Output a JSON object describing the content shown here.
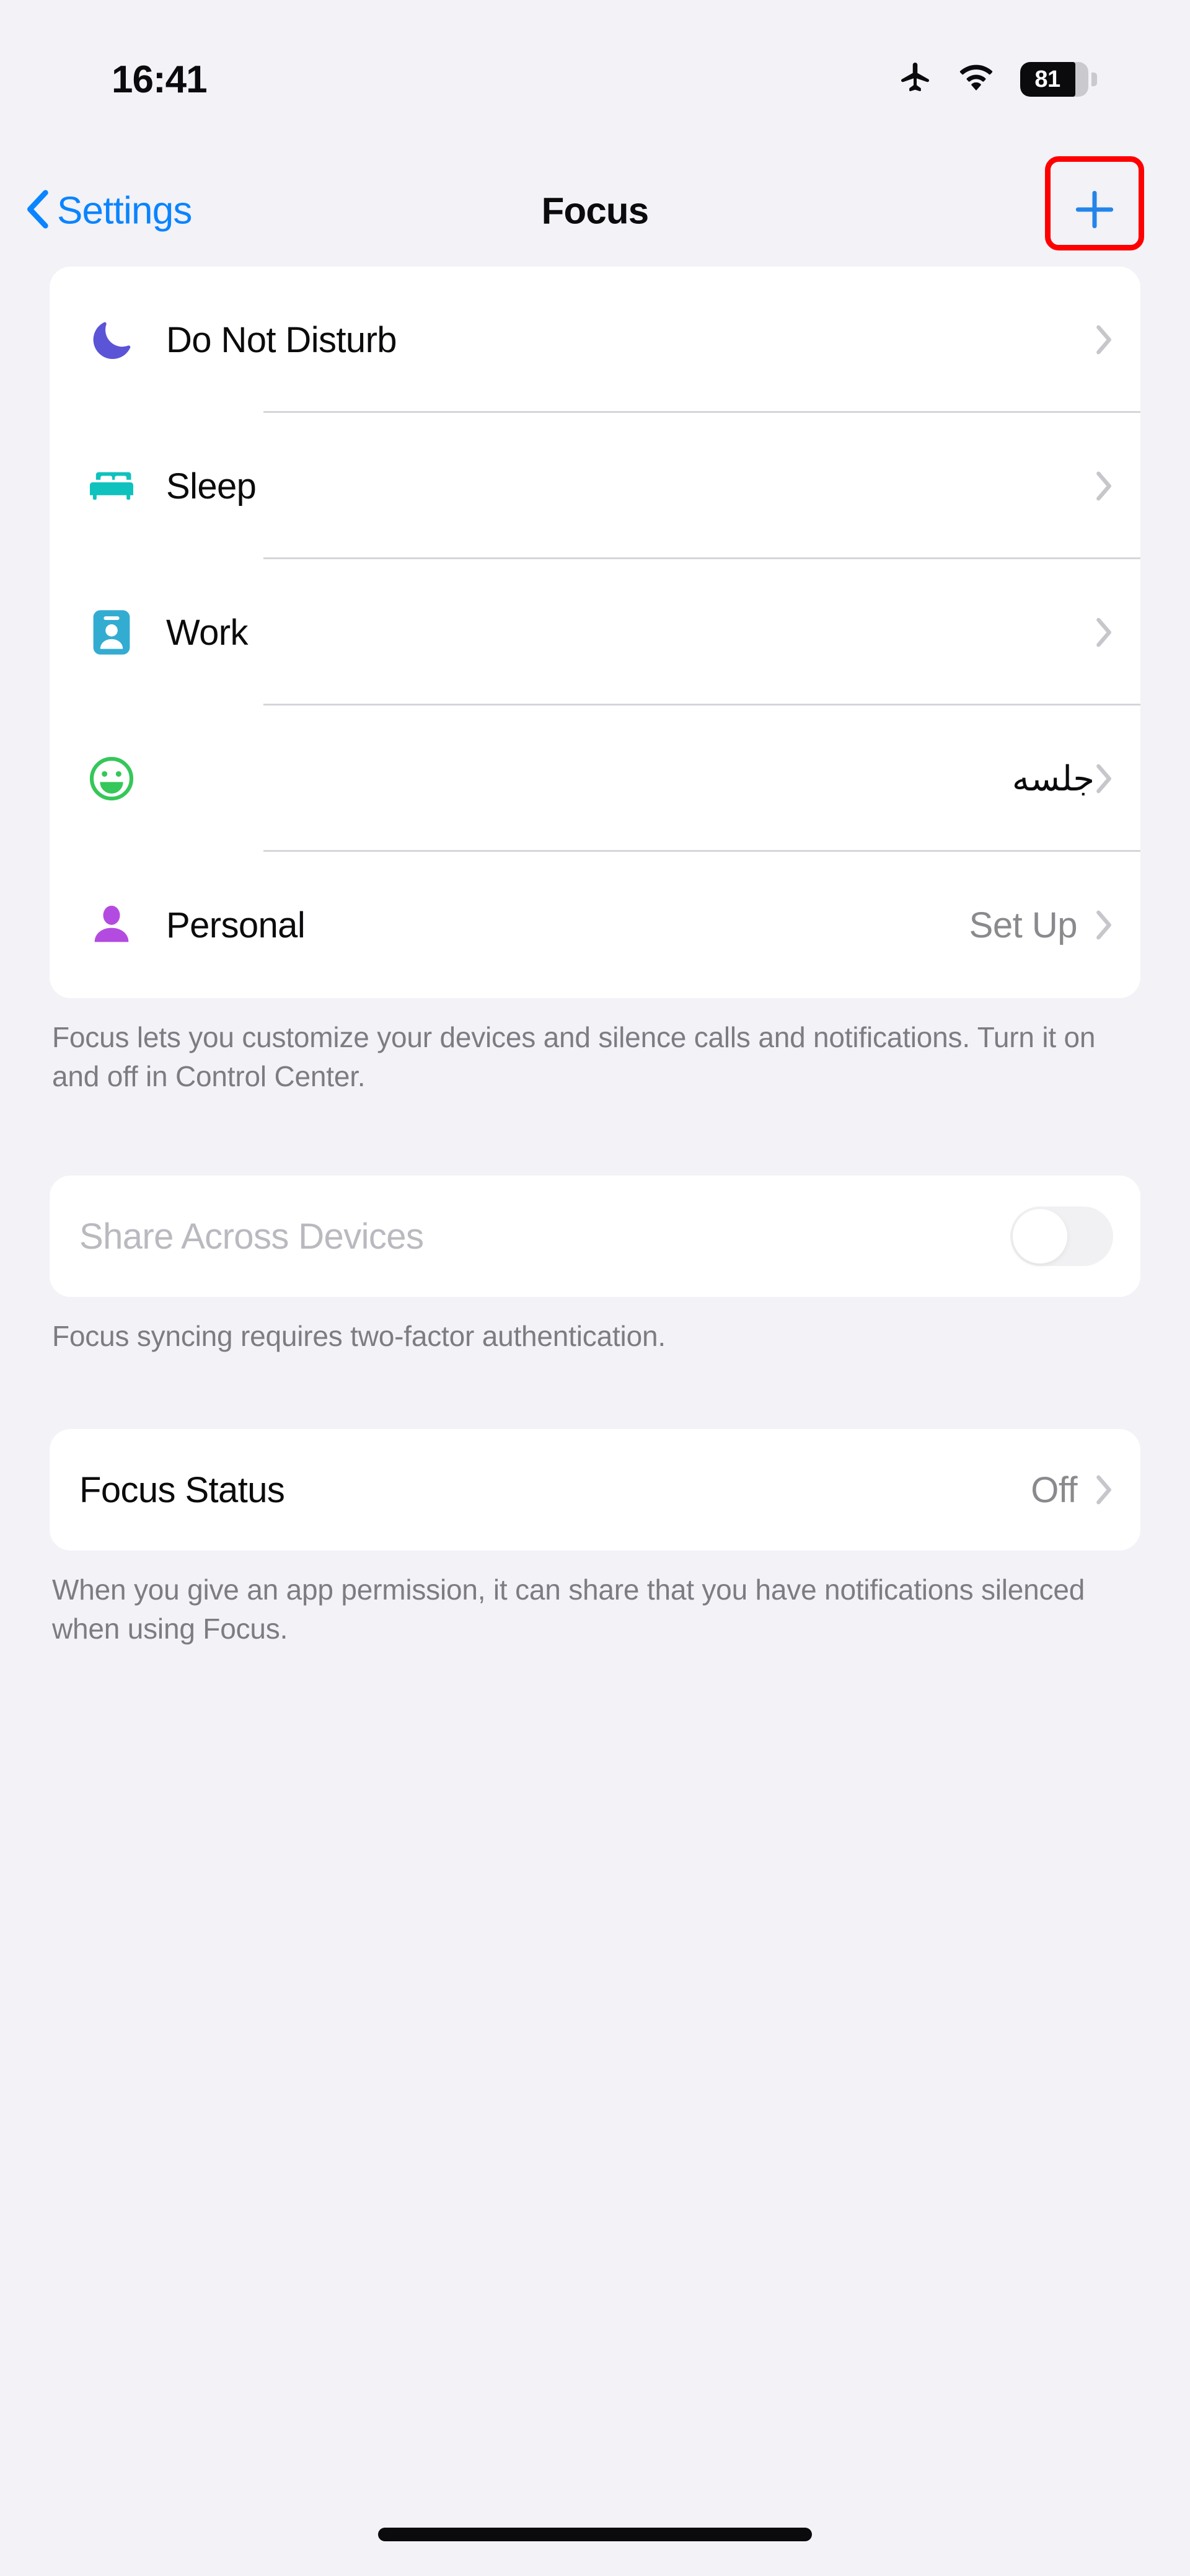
{
  "status_bar": {
    "time": "16:41",
    "airplane_icon": "airplane-mode-icon",
    "wifi_icon": "wifi-icon",
    "battery_percent": "81",
    "battery_level": 81
  },
  "nav": {
    "back_label": "Settings",
    "back_icon": "chevron-left-icon",
    "title": "Focus",
    "add_icon": "plus-icon",
    "add_highlight_color": "#FF0000"
  },
  "colors": {
    "accent_blue": "#0A84FF",
    "page_background": "#F2F2F7",
    "card_background": "#FFFFFF",
    "separator": "#D5D5DA",
    "secondary_text": "#7C7C82"
  },
  "focus_list": {
    "items": [
      {
        "label": "Do Not Disturb",
        "icon": "moon-icon",
        "icon_color": "#5B54D6",
        "value": "",
        "disclosure": "chevron-right-icon"
      },
      {
        "label": "Sleep",
        "icon": "bed-icon",
        "icon_color": "#0FC2BD",
        "value": "",
        "disclosure": "chevron-right-icon"
      },
      {
        "label": "Work",
        "icon": "id-badge-icon",
        "icon_color": "#33ACD2",
        "value": "",
        "disclosure": "chevron-right-icon"
      },
      {
        "label": "جلسه",
        "icon": "smiley-face-icon",
        "icon_color": "#35C759",
        "value": "",
        "disclosure": "chevron-right-icon",
        "rtl": true
      },
      {
        "label": "Personal",
        "icon": "person-icon",
        "icon_color": "#B44BE0",
        "value": "Set Up",
        "disclosure": "chevron-right-icon"
      }
    ],
    "footnote": "Focus lets you customize your devices and silence calls and notifications. Turn it on and off in Control Center."
  },
  "share_section": {
    "label": "Share Across Devices",
    "enabled": false,
    "toggle_on": false,
    "footnote": "Focus syncing requires two-factor authentication."
  },
  "status_section": {
    "label": "Focus Status",
    "value": "Off",
    "disclosure": "chevron-right-icon",
    "footnote": "When you give an app permission, it can share that you have notifications silenced when using Focus."
  },
  "home_indicator": "home-indicator"
}
